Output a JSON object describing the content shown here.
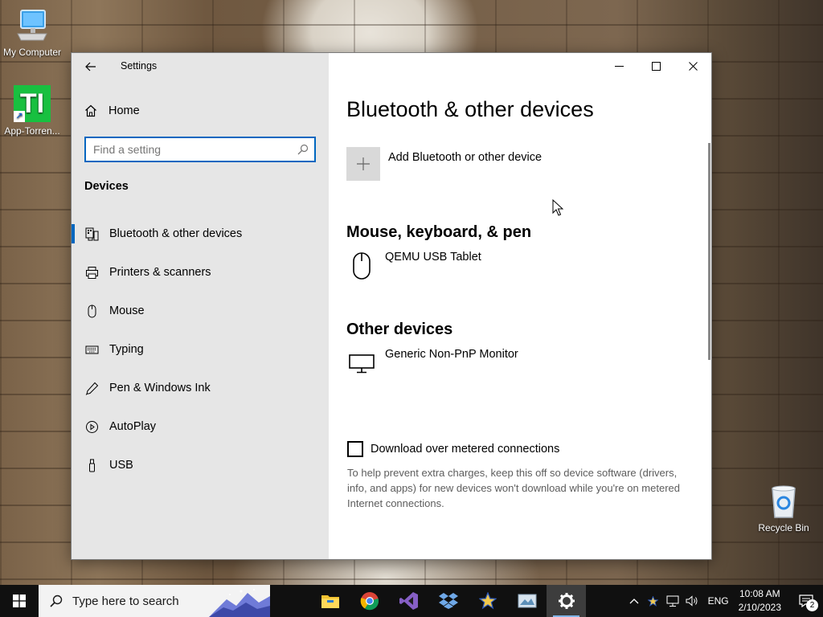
{
  "desktop": {
    "icons": [
      {
        "label": "My Computer"
      },
      {
        "label": "App-Torren...",
        "tile_text": "TI"
      },
      {
        "label": "Recycle Bin"
      }
    ]
  },
  "window": {
    "title": "Settings"
  },
  "nav": {
    "home_label": "Home",
    "search_placeholder": "Find a setting",
    "section_title": "Devices",
    "items": [
      {
        "label": "Bluetooth & other devices",
        "icon": "bluetooth-devices-icon"
      },
      {
        "label": "Printers & scanners",
        "icon": "printer-icon"
      },
      {
        "label": "Mouse",
        "icon": "mouse-icon"
      },
      {
        "label": "Typing",
        "icon": "keyboard-icon"
      },
      {
        "label": "Pen & Windows Ink",
        "icon": "pen-icon"
      },
      {
        "label": "AutoPlay",
        "icon": "autoplay-icon"
      },
      {
        "label": "USB",
        "icon": "usb-icon"
      }
    ]
  },
  "content": {
    "title": "Bluetooth & other devices",
    "add_device_label": "Add Bluetooth or other device",
    "groups": [
      {
        "title": "Mouse, keyboard, & pen",
        "devices": [
          {
            "name": "QEMU USB Tablet",
            "icon": "mouse-icon"
          }
        ]
      },
      {
        "title": "Other devices",
        "devices": [
          {
            "name": "Generic Non-PnP Monitor",
            "icon": "monitor-icon"
          }
        ]
      }
    ],
    "metered_label": "Download over metered connections",
    "metered_checked": false,
    "help_text": "To help prevent extra charges, keep this off so device software (drivers, info, and apps) for new devices won't download while you're on metered Internet connections."
  },
  "taskbar": {
    "search_placeholder": "Type here to search",
    "apps": [
      "file-explorer-icon",
      "chrome-icon",
      "visual-studio-icon",
      "dropbox-icon",
      "star-app-icon",
      "photos-app-icon",
      "settings-gear-icon"
    ],
    "language": "ENG",
    "time": "10:08 AM",
    "date": "2/10/2023",
    "notification_count": "2"
  },
  "colors": {
    "accent": "#0067c0",
    "nav_bg": "#e6e6e6",
    "taskbar_bg": "#101010"
  }
}
